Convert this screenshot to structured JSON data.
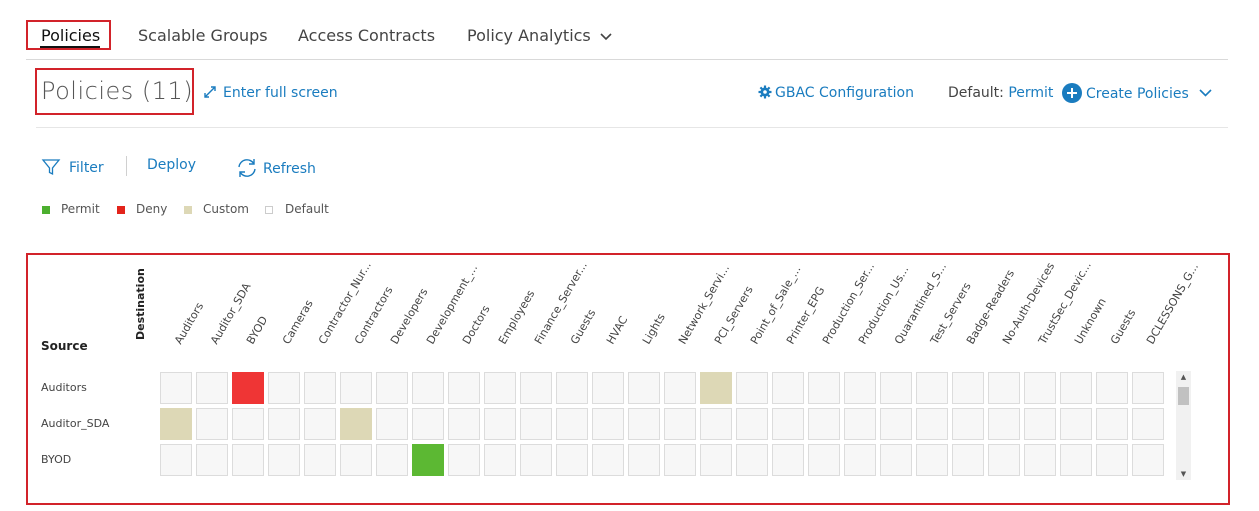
{
  "tabs": [
    {
      "label": "Policies",
      "active": true
    },
    {
      "label": "Scalable Groups"
    },
    {
      "label": "Access Contracts"
    },
    {
      "label": "Policy Analytics",
      "has_dropdown": true
    }
  ],
  "header": {
    "title": "Policies (11)",
    "fullscreen_label": "Enter full screen",
    "gbac_label": "GBAC Configuration",
    "default_prefix": "Default:",
    "default_value": "Permit",
    "create_label": "Create Policies"
  },
  "toolbar": {
    "filter_label": "Filter",
    "deploy_label": "Deploy",
    "refresh_label": "Refresh"
  },
  "legend": [
    {
      "label": "Permit",
      "color": "#4caf2f"
    },
    {
      "label": "Deny",
      "color": "#e3241b"
    },
    {
      "label": "Custom",
      "color": "#ddd8b6"
    },
    {
      "label": "Default",
      "color": "#ffffff"
    }
  ],
  "colors": {
    "accent": "#1a7cbf",
    "highlight_box": "#d2232a",
    "permit": "#5cb833",
    "deny": "#ef3535",
    "custom": "#ddd8b6"
  },
  "matrix": {
    "destination_label": "Destination",
    "source_label": "Source",
    "columns": [
      "Auditors",
      "Auditor_SDA",
      "BYOD",
      "Cameras",
      "Contractor_Nur...",
      "Contractors",
      "Developers",
      "Development_...",
      "Doctors",
      "Employees",
      "Finance_Server...",
      "Guests",
      "HVAC",
      "Lights",
      "Network_Servi...",
      "PCI_Servers",
      "Point_of_Sale_...",
      "Printer_EPG",
      "Production_Ser...",
      "Production_Us...",
      "Quarantined_S...",
      "Test_Servers",
      "Badge-Readers",
      "No-Auth-Devices",
      "TrustSec_Devic...",
      "Unknown",
      "Guests",
      "DCLESSONS_G..."
    ],
    "rows": [
      {
        "label": "Auditors",
        "cells": {
          "2": "deny",
          "15": "custom"
        }
      },
      {
        "label": "Auditor_SDA",
        "cells": {
          "0": "custom",
          "5": "custom"
        }
      },
      {
        "label": "BYOD",
        "cells": {
          "7": "permit"
        }
      }
    ]
  }
}
